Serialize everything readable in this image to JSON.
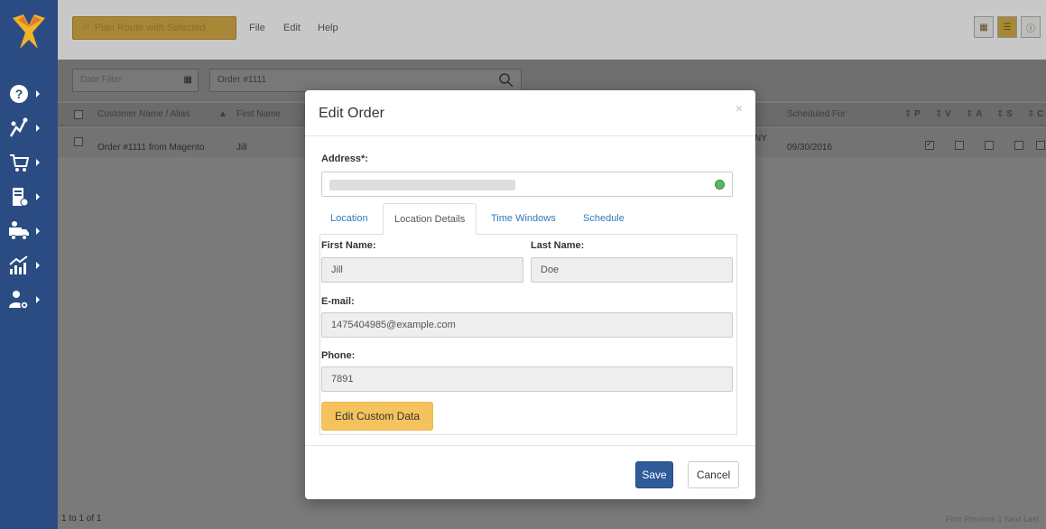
{
  "toolbar": {
    "plan_route_label": "Plan Route with Selected",
    "menu_file": "File",
    "menu_edit": "Edit",
    "menu_help": "Help"
  },
  "filters": {
    "date_placeholder": "Date Filter",
    "order_search_value": "Order #1111"
  },
  "table": {
    "columns": [
      "Customer Name / Alias",
      "First Name",
      "Scheduled For",
      "P",
      "V",
      "A",
      "S",
      "C"
    ],
    "rows": [
      {
        "name": "Order #1111 from Magento",
        "first_name": "Jill",
        "partial": "NY",
        "scheduled": "09/30/2016"
      }
    ]
  },
  "footer": {
    "count": "1 to 1 of 1",
    "pager": "First  Previous  1  Next  Last"
  },
  "modal": {
    "title": "Edit Order",
    "close": "×",
    "address_label": "Address*:",
    "tabs": [
      "Location",
      "Location Details",
      "Time Windows",
      "Schedule"
    ],
    "first_name_label": "First Name:",
    "first_name": "Jill",
    "last_name_label": "Last Name:",
    "last_name": "Doe",
    "email_label": "E-mail:",
    "email": "1475404985@example.com",
    "phone_label": "Phone:",
    "phone": "7891",
    "custom_data_label": "Edit Custom Data",
    "save_label": "Save",
    "cancel_label": "Cancel"
  },
  "colors": {
    "sidebar": "#2b4c82",
    "accent": "#f5c35e",
    "primary": "#2f5b99",
    "status_ok": "#5cb85c"
  }
}
